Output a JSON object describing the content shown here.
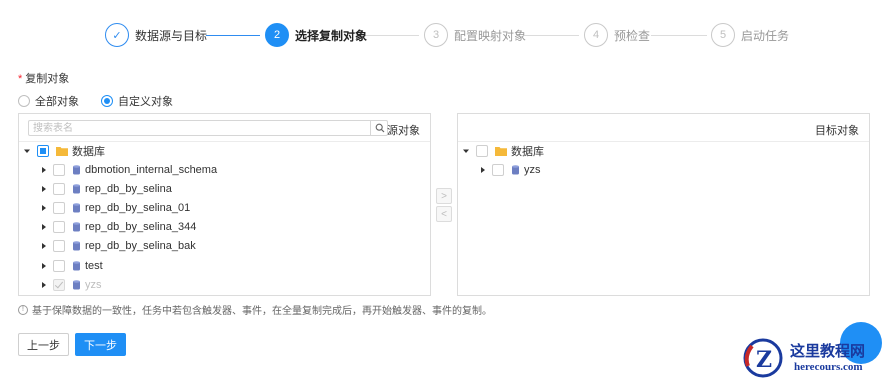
{
  "steps": [
    {
      "label": "数据源与目标",
      "number": "✓",
      "state": "done"
    },
    {
      "label": "选择复制对象",
      "number": "2",
      "state": "active"
    },
    {
      "label": "配置映射对象",
      "number": "3",
      "state": "pending"
    },
    {
      "label": "预检查",
      "number": "4",
      "state": "pending"
    },
    {
      "label": "启动任务",
      "number": "5",
      "state": "pending"
    }
  ],
  "form": {
    "required_mark": "*",
    "label": "复制对象",
    "radio_options": [
      {
        "label": "全部对象",
        "selected": false
      },
      {
        "label": "自定义对象",
        "selected": true
      }
    ]
  },
  "source_panel": {
    "title": "源对象",
    "search_placeholder": "搜索表名",
    "search_icon": "search-icon",
    "root": {
      "label": "数据库",
      "check": "partial",
      "expanded": true
    },
    "items": [
      {
        "label": "dbmotion_internal_schema",
        "disabled": false
      },
      {
        "label": "rep_db_by_selina",
        "disabled": false
      },
      {
        "label": "rep_db_by_selina_01",
        "disabled": false
      },
      {
        "label": "rep_db_by_selina_344",
        "disabled": false
      },
      {
        "label": "rep_db_by_selina_bak",
        "disabled": false
      },
      {
        "label": "test",
        "disabled": false
      },
      {
        "label": "yzs",
        "disabled": true
      }
    ]
  },
  "target_panel": {
    "title": "目标对象",
    "root": {
      "label": "数据库",
      "check": "none",
      "expanded": true
    },
    "items": [
      {
        "label": "yzs",
        "disabled": false
      }
    ]
  },
  "transfer": {
    "right": ">",
    "left": "<"
  },
  "note": {
    "icon": "info-icon",
    "text": "基于保障数据的一致性，任务中若包含触发器、事件，在全量复制完成后，再开始触发器、事件的复制。"
  },
  "buttons": {
    "prev": "上一步",
    "next": "下一步"
  },
  "watermark": {
    "title": "这里教程网",
    "url": "herecours.com"
  },
  "colors": {
    "primary": "#1f8ff5",
    "required": "#f5222d",
    "folder": "#f5b93a",
    "database": "#6d7fc2",
    "watermark": "#1a3a9e"
  }
}
